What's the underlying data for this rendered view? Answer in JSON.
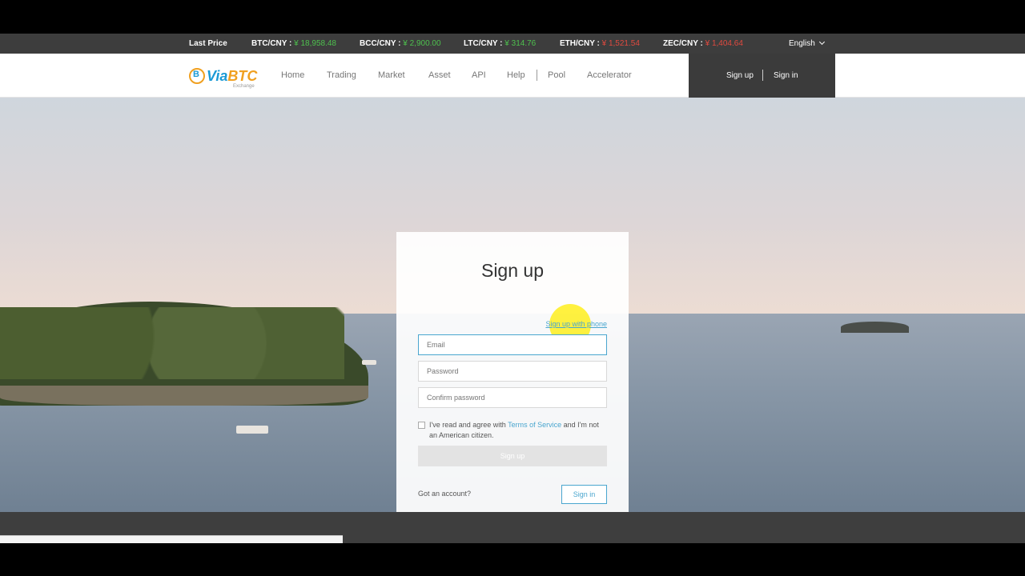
{
  "ticker": {
    "last_price": "Last Price",
    "pairs": [
      {
        "pair": "BTC/CNY :",
        "price": "¥ 18,958.48"
      },
      {
        "pair": "BCC/CNY :",
        "price": "¥ 2,900.00"
      },
      {
        "pair": "LTC/CNY :",
        "price": "¥ 314.76"
      },
      {
        "pair": "ETH/CNY :",
        "price": "¥ 1,521.54"
      },
      {
        "pair": "ZEC/CNY :",
        "price": "¥ 1,404.64"
      }
    ],
    "language": "English"
  },
  "nav": {
    "logo_main": "Via",
    "logo_accent": "BTC",
    "logo_sub": "Exchange",
    "links": [
      "Home",
      "Trading",
      "Market",
      "Asset",
      "API",
      "Help",
      "Pool",
      "Accelerator"
    ],
    "signup": "Sign up",
    "signin": "Sign in"
  },
  "card": {
    "title": "Sign up",
    "phone_link": "Sign up with phone",
    "email_placeholder": "Email",
    "password_placeholder": "Password",
    "confirm_placeholder": "Confirm password",
    "agree_prefix": "I've read and agree with ",
    "agree_link": "Terms of Service",
    "agree_suffix": " and I'm not an American citizen.",
    "submit": "Sign up",
    "got_account": "Got an account?",
    "signin": "Sign in"
  },
  "colors": {
    "accent": "#4aa6cf",
    "price_up": "#4ec04e",
    "price_down": "#e04a3f",
    "dark_bar": "#3d3d3d"
  }
}
